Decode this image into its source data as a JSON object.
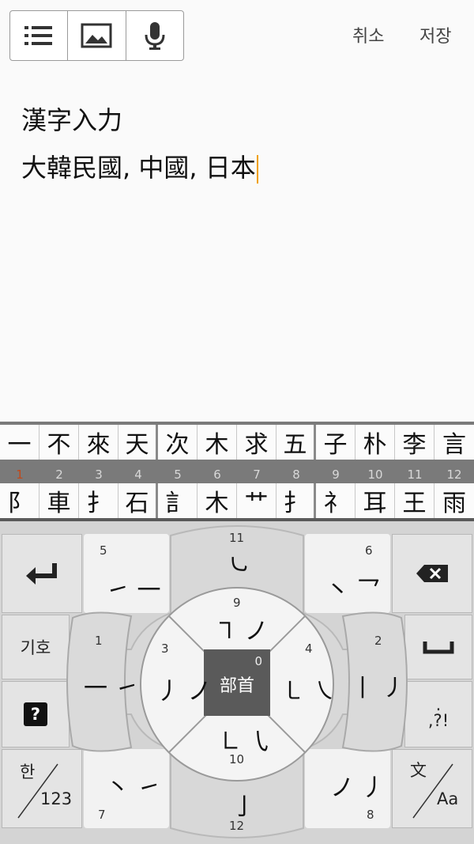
{
  "toolbar": {
    "list_icon": "list-icon",
    "image_icon": "image-icon",
    "mic_icon": "microphone-icon"
  },
  "actions": {
    "cancel": "취소",
    "save": "저장"
  },
  "editor": {
    "line1": "漢字入力",
    "line2": "大韓民國, 中國, 日本"
  },
  "keyboard": {
    "candidates": [
      "一",
      "不",
      "來",
      "天",
      "次",
      "木",
      "求",
      "五",
      "子",
      "朴",
      "李",
      "言"
    ],
    "numbers": [
      "1",
      "2",
      "3",
      "4",
      "5",
      "6",
      "7",
      "8",
      "9",
      "10",
      "11",
      "12"
    ],
    "radicals": [
      "阝",
      "車",
      "扌",
      "石",
      "訁",
      "木",
      "艹",
      "扌",
      "礻",
      "耳",
      "王",
      "雨"
    ],
    "center_label": "部首",
    "center_num": "0",
    "symbols_label": "기호",
    "help_label": "?",
    "punct_top": ".",
    "punct_bottom": ",?!",
    "lang_han": "한",
    "lang_123": "123",
    "mode_wen": "文",
    "mode_aa": "Aa",
    "strokes": {
      "k1": {
        "num": "1",
        "glyph": "一 ㇀"
      },
      "k2": {
        "num": "2",
        "glyph": "丨 ㇓"
      },
      "k3": {
        "num": "3",
        "glyph": "丿 ノ"
      },
      "k4": {
        "num": "4",
        "glyph": "㇄ ㇏"
      },
      "k5": {
        "num": "5",
        "glyph": "㇀ 一"
      },
      "k6": {
        "num": "6",
        "glyph": "㇔ 乛"
      },
      "k7": {
        "num": "7",
        "glyph": "丶 ㇀"
      },
      "k8": {
        "num": "8",
        "glyph": "ノ 丿"
      },
      "k9": {
        "num": "9",
        "glyph": "㇕ ノ"
      },
      "k10": {
        "num": "10",
        "glyph": "㇗ ㇂"
      },
      "k11": {
        "num": "11",
        "glyph": "㇃"
      },
      "k12": {
        "num": "12",
        "glyph": "亅"
      }
    }
  }
}
